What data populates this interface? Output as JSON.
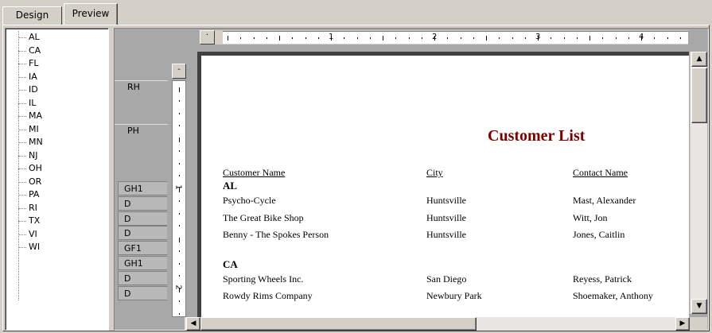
{
  "tabs": [
    {
      "label": "Design"
    },
    {
      "label": "Preview"
    }
  ],
  "tree": {
    "items": [
      "AL",
      "CA",
      "FL",
      "IA",
      "ID",
      "IL",
      "MA",
      "MI",
      "MN",
      "NJ",
      "OH",
      "OR",
      "PA",
      "RI",
      "TX",
      "VI",
      "WI"
    ]
  },
  "bands": {
    "report_header": "RH",
    "page_header": "PH",
    "rows": [
      "GH1",
      "D",
      "D",
      "D",
      "GF1",
      "GH1",
      "D",
      "D"
    ]
  },
  "ruler": {
    "corner": "·",
    "vhead": "-",
    "h_numbers": [
      "1",
      "2",
      "3",
      "4"
    ],
    "v_numbers": [
      "1",
      "2"
    ]
  },
  "report": {
    "title": "Customer List",
    "columns": [
      "Customer Name",
      "City",
      "Contact Name"
    ],
    "groups": [
      {
        "state": "AL",
        "rows": [
          [
            "Psycho-Cycle",
            "Huntsville",
            "Mast, Alexander"
          ],
          [
            "The Great Bike Shop",
            "Huntsville",
            "Witt, Jon"
          ],
          [
            "Benny - The Spokes Person",
            "Huntsville",
            "Jones, Caitlin"
          ]
        ]
      },
      {
        "state": "CA",
        "rows": [
          [
            "Sporting Wheels Inc.",
            "San Diego",
            "Reyess, Patrick"
          ],
          [
            "Rowdy Rims Company",
            "Newbury Park",
            "Shoemaker, Anthony"
          ]
        ]
      }
    ]
  },
  "icons": {
    "scroll_up": "▲",
    "scroll_down": "▼",
    "scroll_left": "◀",
    "scroll_right": "▶"
  },
  "colors": {
    "title": "#7b0000",
    "window": "#d4d0c8"
  }
}
